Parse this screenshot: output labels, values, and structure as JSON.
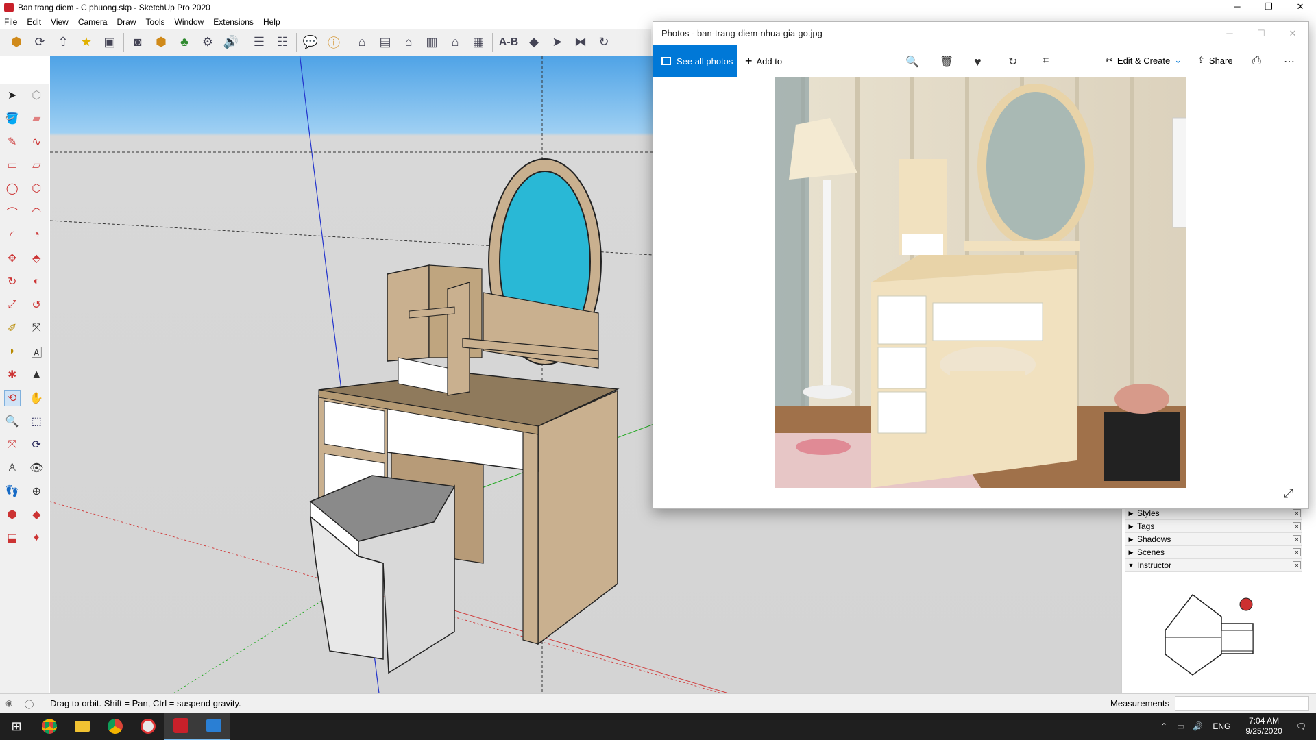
{
  "sketchup": {
    "title": "Ban trang diem - C phuong.skp - SketchUp Pro 2020",
    "window_controls": {
      "minimize": "─",
      "restore": "❐",
      "close": "✕"
    },
    "menu": [
      "File",
      "Edit",
      "View",
      "Camera",
      "Draw",
      "Tools",
      "Window",
      "Extensions",
      "Help"
    ],
    "toolbar_text_tool": "A-B",
    "status_text": "Drag to orbit. Shift = Pan, Ctrl = suspend gravity.",
    "measurements_label": "Measurements",
    "tray_items": [
      {
        "label": "Styles",
        "expanded": false
      },
      {
        "label": "Tags",
        "expanded": false
      },
      {
        "label": "Shadows",
        "expanded": false
      },
      {
        "label": "Scenes",
        "expanded": false
      },
      {
        "label": "Instructor",
        "expanded": true
      }
    ]
  },
  "photos": {
    "title": "Photos - ban-trang-diem-nhua-gia-go.jpg",
    "see_all_label": "See all photos",
    "add_to_label": "Add to",
    "edit_create_label": "Edit & Create",
    "share_label": "Share"
  },
  "taskbar": {
    "language": "ENG",
    "time": "7:04 AM",
    "date": "9/25/2020"
  },
  "colors": {
    "accent": "#0078d7",
    "sky": "#4fa3e6",
    "ground": "#d4d4d4",
    "wood": "#c9b08f",
    "mirror": "#29b8d6"
  }
}
